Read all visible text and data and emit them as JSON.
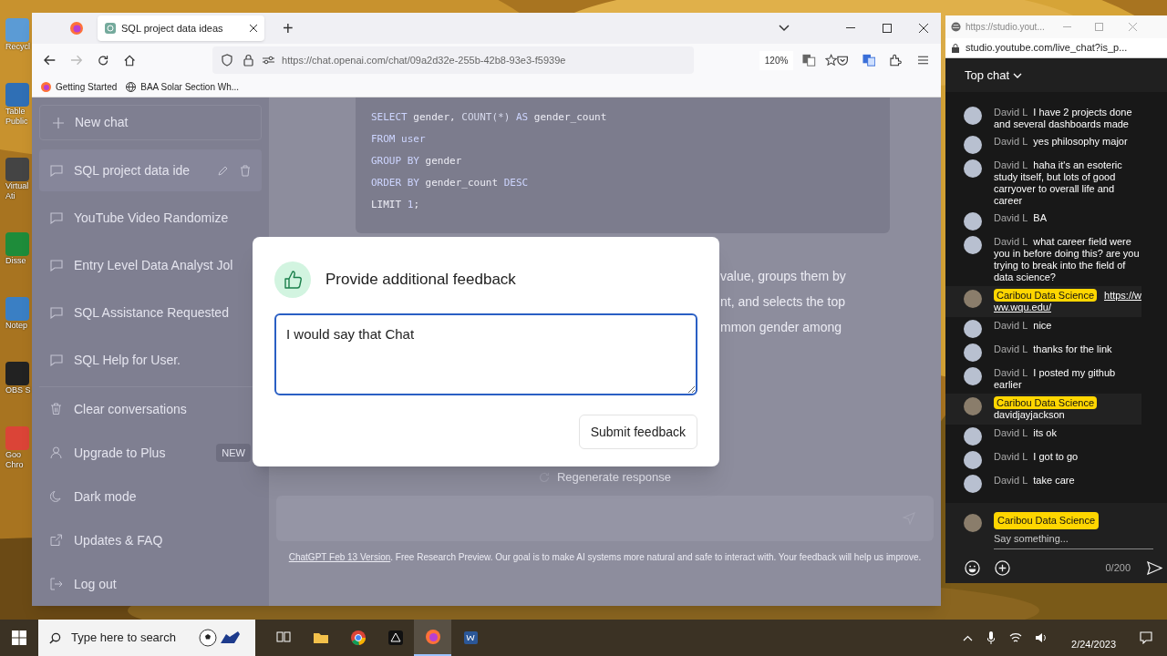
{
  "desktop": {
    "icons": [
      {
        "lines": [
          "Recycl"
        ],
        "color": "#5b9bd5"
      },
      {
        "lines": [
          "Table",
          "Public"
        ],
        "color": "#2f6fb5"
      },
      {
        "lines": [
          "Virtual",
          "Ati"
        ],
        "color": "#444444"
      },
      {
        "lines": [
          "Disse"
        ],
        "color": "#1e8c3a"
      },
      {
        "lines": [
          "Notep"
        ],
        "color": "#3a7fc4"
      },
      {
        "lines": [
          "OBS S"
        ],
        "color": "#222222"
      },
      {
        "lines": [
          "Goo",
          "Chro"
        ],
        "color": "#db4437"
      }
    ]
  },
  "browser": {
    "tabs": [
      {
        "title": "SQL project data ideas",
        "selected": true
      }
    ],
    "new_tab": "+",
    "url": "https://chat.openai.com/chat/09a2d32e-255b-42b8-93e3-f5939e",
    "zoom": "120%",
    "bookmarks": [
      {
        "label": "Getting Started",
        "kind": "firefox"
      },
      {
        "label": "BAA Solar Section Wh...",
        "kind": "globe"
      }
    ]
  },
  "sidebar": {
    "new_chat": "New chat",
    "conversations": [
      {
        "title": "SQL project data ide",
        "selected": true
      },
      {
        "title": "YouTube Video Randomize",
        "selected": false
      },
      {
        "title": "Entry Level Data Analyst Jol",
        "selected": false
      },
      {
        "title": "SQL Assistance Requested",
        "selected": false
      },
      {
        "title": "SQL Help for User.",
        "selected": false
      }
    ],
    "menu": [
      {
        "label": "Clear conversations",
        "kind": "trash"
      },
      {
        "label": "Upgrade to Plus",
        "kind": "user",
        "badge": "NEW"
      },
      {
        "label": "Dark mode",
        "kind": "moon"
      },
      {
        "label": "Updates & FAQ",
        "kind": "external"
      },
      {
        "label": "Log out",
        "kind": "logout"
      }
    ]
  },
  "code": {
    "lines": [
      [
        {
          "text": "SELECT",
          "kind": "keyword"
        },
        {
          "text": " gender, ",
          "kind": "plain"
        },
        {
          "text": "COUNT",
          "kind": "function"
        },
        {
          "text": "(*) ",
          "kind": "function"
        },
        {
          "text": "AS",
          "kind": "keyword"
        },
        {
          "text": " gender_count",
          "kind": "plain"
        }
      ],
      [
        {
          "text": "FROM",
          "kind": "keyword"
        },
        {
          "text": " user",
          "kind": "keyword"
        }
      ],
      [
        {
          "text": "GROUP BY",
          "kind": "keyword"
        },
        {
          "text": " gender",
          "kind": "plain"
        }
      ],
      [
        {
          "text": "ORDER BY",
          "kind": "keyword"
        },
        {
          "text": " gender_count ",
          "kind": "plain"
        },
        {
          "text": "DESC",
          "kind": "keyword"
        }
      ],
      [
        {
          "text": "LIMIT ",
          "kind": "plain"
        },
        {
          "text": "1",
          "kind": "number"
        },
        {
          "text": ";",
          "kind": "plain"
        }
      ]
    ]
  },
  "answer_lines": [
    "value, groups them by",
    "nt, and selects the top",
    "mmon gender among"
  ],
  "regenerate": "Regenerate response",
  "footer": {
    "link": "ChatGPT Feb 13 Version",
    "text": ". Free Research Preview. Our goal is to make AI systems more natural and safe to interact with. Your feedback will help us improve."
  },
  "feedback_dialog": {
    "title": "Provide additional feedback",
    "value": "I would say that Chat",
    "submit": "Submit feedback"
  },
  "live_chat": {
    "window_title": "https://studio.yout...",
    "url": "studio.youtube.com/live_chat?is_p...",
    "header": "Top chat",
    "messages": [
      {
        "author": "David L",
        "text": "I have 2 projects done and several dashboards made",
        "kind": "viewer"
      },
      {
        "author": "David L",
        "text": "yes philosophy major",
        "kind": "viewer"
      },
      {
        "author": "David L",
        "text": "haha it's an esoteric study itself, but lots of good carryover to overall life and career",
        "kind": "viewer"
      },
      {
        "author": "David L",
        "text": "BA",
        "kind": "viewer"
      },
      {
        "author": "David L",
        "text": "what career field were you in before doing this? are you trying to break into the field of data science?",
        "kind": "viewer"
      },
      {
        "author": "Caribou Data Science",
        "text": "https://www.wqu.edu/",
        "kind": "owner_link"
      },
      {
        "author": "David L",
        "text": "nice",
        "kind": "viewer"
      },
      {
        "author": "David L",
        "text": "thanks for the link",
        "kind": "viewer"
      },
      {
        "author": "David L",
        "text": "I posted my github earlier",
        "kind": "viewer"
      },
      {
        "author": "Caribou Data Science",
        "text": "davidjayjackson",
        "kind": "owner"
      },
      {
        "author": "David L",
        "text": "its ok",
        "kind": "viewer"
      },
      {
        "author": "David L",
        "text": "I got to go",
        "kind": "viewer"
      },
      {
        "author": "David L",
        "text": "take care",
        "kind": "viewer"
      }
    ],
    "composer": {
      "author": "Caribou Data Science",
      "placeholder": "Say something...",
      "counter": "0/200"
    }
  },
  "taskbar": {
    "search_placeholder": "Type here to search",
    "apps": [
      {
        "kind": "taskview",
        "active": false
      },
      {
        "kind": "folder",
        "active": false
      },
      {
        "kind": "chrome",
        "active": false
      },
      {
        "kind": "prism",
        "active": false
      },
      {
        "kind": "firefox",
        "active": true
      },
      {
        "kind": "word",
        "active": false
      }
    ],
    "date": "2/24/2023"
  }
}
